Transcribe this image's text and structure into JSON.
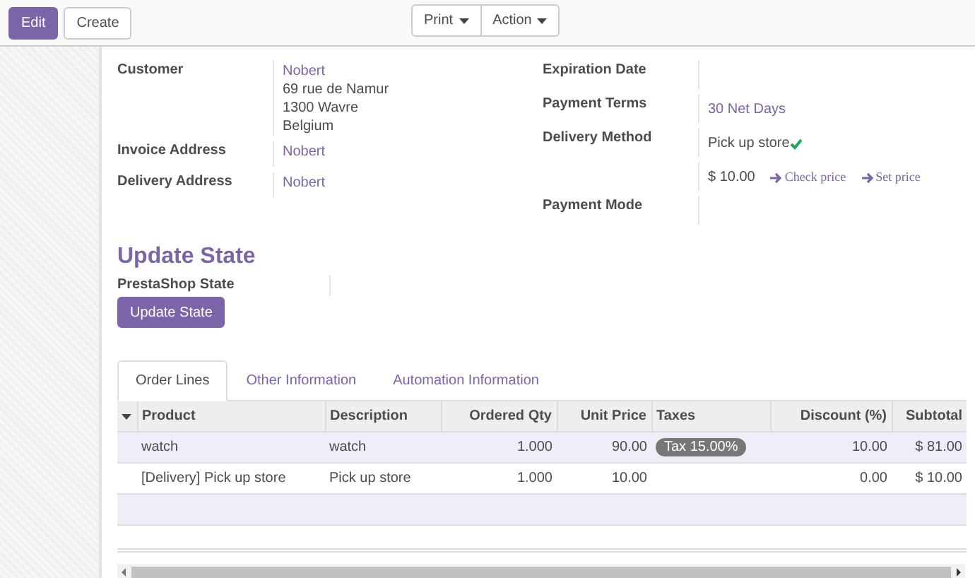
{
  "toolbar": {
    "left_buttons": [
      {
        "label": "Edit",
        "kind": "primary"
      },
      {
        "label": "Create",
        "kind": "default"
      }
    ],
    "dropdowns": [
      "Print",
      "Action"
    ]
  },
  "form": {
    "left_fields": [
      {
        "label": "Customer",
        "lines": [
          {
            "text": "Nobert",
            "link": true
          },
          {
            "text": "69 rue de Namur",
            "link": false
          },
          {
            "text": "1300 Wavre",
            "link": false
          },
          {
            "text": "Belgium",
            "link": false
          }
        ]
      },
      {
        "label": "Invoice Address",
        "lines": [
          {
            "text": "Nobert",
            "link": true
          }
        ]
      },
      {
        "label": "Delivery Address",
        "lines": [
          {
            "text": "Nobert",
            "link": true
          }
        ]
      }
    ],
    "right_fields": [
      {
        "label": "Expiration Date"
      },
      {
        "label": "Payment Terms",
        "value": "30 Net Days",
        "link": true
      },
      {
        "label": "Delivery Method",
        "value": "Pick up store",
        "link": false,
        "verified": true
      },
      {
        "price": "$ 10.00",
        "actions": [
          "Check price",
          "Set price"
        ]
      },
      {
        "label": "Payment Mode"
      }
    ],
    "section_title": "Update State",
    "state_label": "PrestaShop State",
    "state_button": "Update State"
  },
  "tabs": [
    {
      "label": "Order Lines",
      "selected": true
    },
    {
      "label": "Other Information",
      "selected": false
    },
    {
      "label": "Automation Information",
      "selected": false
    }
  ],
  "table": {
    "columns": [
      "Product",
      "Description",
      "Ordered Qty",
      "Unit Price",
      "Taxes",
      "Discount (%)",
      "Subtotal"
    ],
    "rows": [
      {
        "cells": [
          "watch",
          "watch",
          "1.000",
          "90.00",
          "",
          "10.00",
          "$ 81.00"
        ],
        "tax_tags": [
          "Tax 15.00%"
        ]
      },
      {
        "cells": [
          "[Delivery] Pick up store",
          "Pick up store",
          "1.000",
          "10.00",
          "",
          "0.00",
          "$ 10.00"
        ],
        "tax_tags": []
      }
    ]
  }
}
